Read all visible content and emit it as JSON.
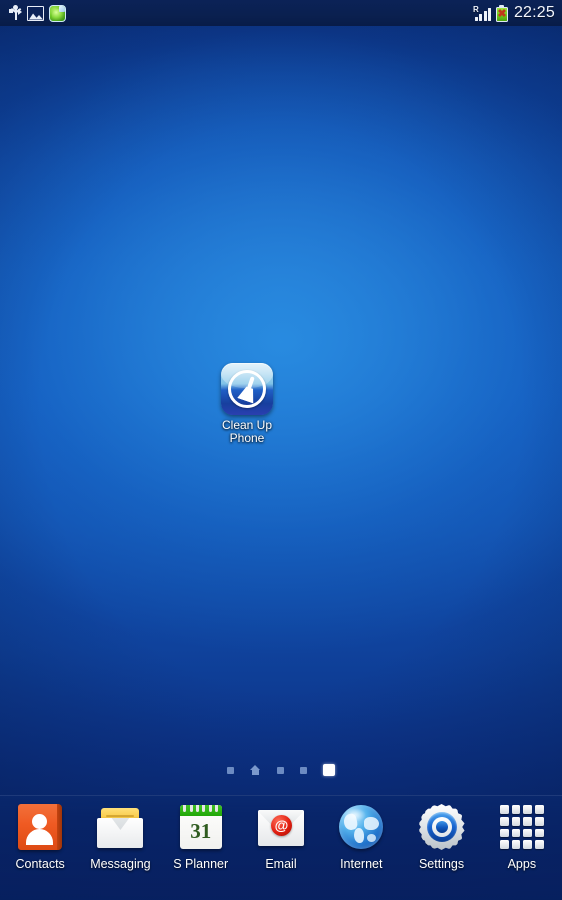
{
  "status_bar": {
    "left_icons": [
      {
        "name": "usb-icon",
        "label": "USB connected"
      },
      {
        "name": "screenshot-icon",
        "label": "Screenshot captured"
      },
      {
        "name": "app-update-icon",
        "label": "App notification"
      }
    ],
    "roaming_indicator": "R",
    "signal_bars": 4,
    "battery": {
      "level_icon": "battery-error",
      "color": "#6fc91e"
    },
    "time": "22:25"
  },
  "wallpaper": {
    "type": "gradient",
    "top_color": "#0b2f7d",
    "center_color": "#1d86e0",
    "bottom_color": "#082363"
  },
  "home": {
    "apps": [
      {
        "name": "clean-up-phone",
        "label": "Clean Up\nPhone",
        "label_line1": "Clean Up",
        "label_line2": "Phone",
        "icon": "broom-icon"
      }
    ]
  },
  "page_indicator": {
    "total_pages": 5,
    "current_page": 5,
    "home_page": 2,
    "pages": [
      {
        "type": "dot",
        "active": false
      },
      {
        "type": "home",
        "active": false
      },
      {
        "type": "dot",
        "active": false
      },
      {
        "type": "dot",
        "active": false
      },
      {
        "type": "dot",
        "active": true
      }
    ]
  },
  "dock": {
    "items": [
      {
        "label": "Contacts",
        "icon": "contacts-icon"
      },
      {
        "label": "Messaging",
        "icon": "messaging-icon"
      },
      {
        "label": "S Planner",
        "icon": "calendar-icon",
        "day": "31"
      },
      {
        "label": "Email",
        "icon": "email-icon",
        "glyph": "@"
      },
      {
        "label": "Internet",
        "icon": "globe-icon"
      },
      {
        "label": "Settings",
        "icon": "gear-icon"
      },
      {
        "label": "Apps",
        "icon": "apps-grid-icon"
      }
    ]
  }
}
